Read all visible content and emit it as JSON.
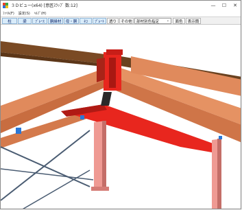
{
  "window": {
    "title": "３Ｄビュー(x64) [意匠ｽﾗｯﾌﾞ 数:12]",
    "minimize": "—",
    "maximize": "☐",
    "close": "✕"
  },
  "menu": {
    "items": [
      "ﾌｧｲﾙ(F)",
      "設定(S)",
      "ﾍﾙﾌﾟ(H)"
    ]
  },
  "toolbar": {
    "buttons": [
      "柱",
      "梁",
      "ﾌﾞﾚｰｽ",
      "胴縁材",
      "母・胴",
      "ﾈｺ",
      "ﾌﾟﾚｰﾄ"
    ],
    "plain_buttons": [
      "透り",
      "その他"
    ],
    "color_mode": "部材別色指定",
    "right_buttons": [
      "面色",
      "表示簡"
    ]
  },
  "colors": {
    "beam_main": "#e08a5c",
    "beam_dark": "#7a4a24",
    "column": "#ef9a93",
    "column_shadow": "#c46e68",
    "plate_red": "#e8261e",
    "brace": "#4a5c72",
    "blue_tag": "#2a77d6"
  }
}
